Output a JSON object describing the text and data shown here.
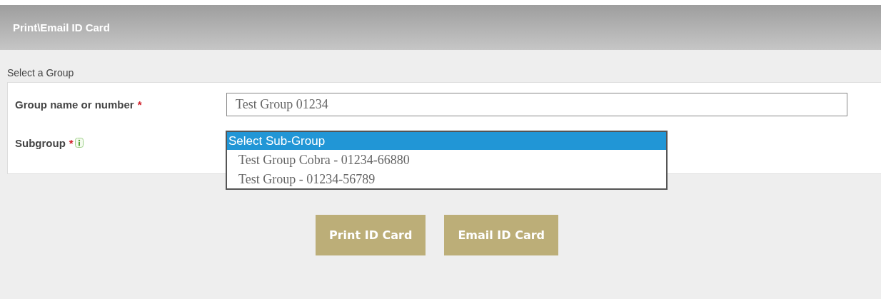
{
  "header": {
    "title": "Print\\Email ID Card"
  },
  "section": {
    "title": "Select a Group"
  },
  "fields": [
    {
      "kind": "text",
      "label": "Group name or number",
      "required_mark": "*",
      "value": "Test Group 01234",
      "info": false
    },
    {
      "kind": "listbox",
      "label": "Subgroup",
      "required_mark": "*",
      "info": true,
      "options": [
        {
          "label": "Select Sub-Group",
          "selected": true
        },
        {
          "label": "Test Group Cobra - 01234-66880",
          "selected": false
        },
        {
          "label": "Test Group - 01234-56789",
          "selected": false
        }
      ]
    }
  ],
  "buttons": [
    "Print ID Card",
    "Email ID Card"
  ]
}
